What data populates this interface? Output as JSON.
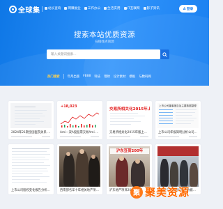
{
  "header": {
    "logo_text": "全球集",
    "nav": [
      {
        "label": "站长查询"
      },
      {
        "label": "网赚副业"
      },
      {
        "label": "工作办公"
      },
      {
        "label": "生活实用"
      },
      {
        "label": "IT互联网"
      },
      {
        "label": "影子资讯"
      }
    ],
    "login_label": "A 登录"
  },
  "hero": {
    "title": "搜索本站优质资源",
    "subtitle": "在线找点资源",
    "search_placeholder": "输入关键词搜索..."
  },
  "hot": {
    "label": "热门搜索",
    "tags": [
      "年月出版",
      "FB88",
      "科技",
      "理财",
      "设计素材",
      "模板",
      "与数码网"
    ]
  },
  "cards_row1": [
    {
      "title": "2024年21期全国医院关系 10周分享..."
    },
    {
      "title": "Ami—双A股股票交易Ami 第A股Ami股..."
    },
    {
      "title": "交易所相关化2015年版上市公司名..."
    },
    {
      "title": "上市公司年报简明分析公司财务报..."
    }
  ],
  "card2_value": "+18,023",
  "card3_headline": "交易所相关化2015年上市公司",
  "card4_title": "上市公司董事报告及主要数据整理",
  "cards_row2": [
    {
      "title": "上市公司股权变化报告分析及..."
    },
    {
      "title": "西南部名华十年相关地产项目整理"
    },
    {
      "title": "沪东地产项目200年数据"
    },
    {
      "title": "1500个人民银行统计数据整理"
    }
  ],
  "card7_overlay": "沪东豆荷200年",
  "watermark": {
    "badge": "聚",
    "text": "聚美资源"
  },
  "colors": {
    "primary": "#1a80f0",
    "accent": "#ffd24d",
    "red": "#e21b1b"
  }
}
